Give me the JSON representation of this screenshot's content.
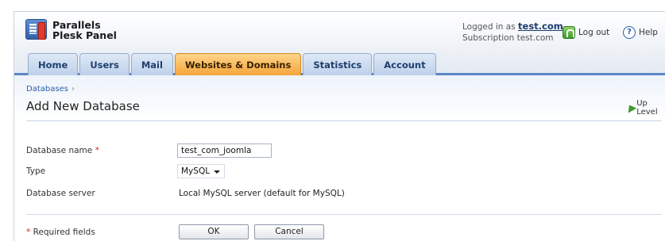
{
  "header": {
    "logo_line1": "Parallels",
    "logo_line2": "Plesk Panel",
    "logged_in_prefix": "Logged in as",
    "username": "test.com",
    "subscription": "Subscription test.com",
    "logout_label": "Log out",
    "help_label": "Help",
    "help_glyph": "?"
  },
  "tabs": [
    {
      "label": "Home",
      "active": false
    },
    {
      "label": "Users",
      "active": false
    },
    {
      "label": "Mail",
      "active": false
    },
    {
      "label": "Websites & Domains",
      "active": true
    },
    {
      "label": "Statistics",
      "active": false
    },
    {
      "label": "Account",
      "active": false
    }
  ],
  "breadcrumb": {
    "item": "Databases",
    "separator": "›"
  },
  "page": {
    "title": "Add New Database",
    "up_level_label": "Up Level"
  },
  "form": {
    "db_name_label": "Database name",
    "required_marker": "*",
    "db_name_value": "test_com_joomla",
    "type_label": "Type",
    "type_value": "MySQL",
    "server_label": "Database server",
    "server_value": "Local MySQL server (default for MySQL)",
    "required_note": "Required fields",
    "ok_label": "OK",
    "cancel_label": "Cancel"
  },
  "colors": {
    "active_tab": "#f5a53a",
    "tab": "#bdd0ea",
    "header_rule": "#5b87c5",
    "required": "#dd2222"
  },
  "icons": {
    "logo": "plesk-logo-icon",
    "logout": "logout-icon",
    "help": "help-icon",
    "up_level": "up-arrow-icon"
  }
}
